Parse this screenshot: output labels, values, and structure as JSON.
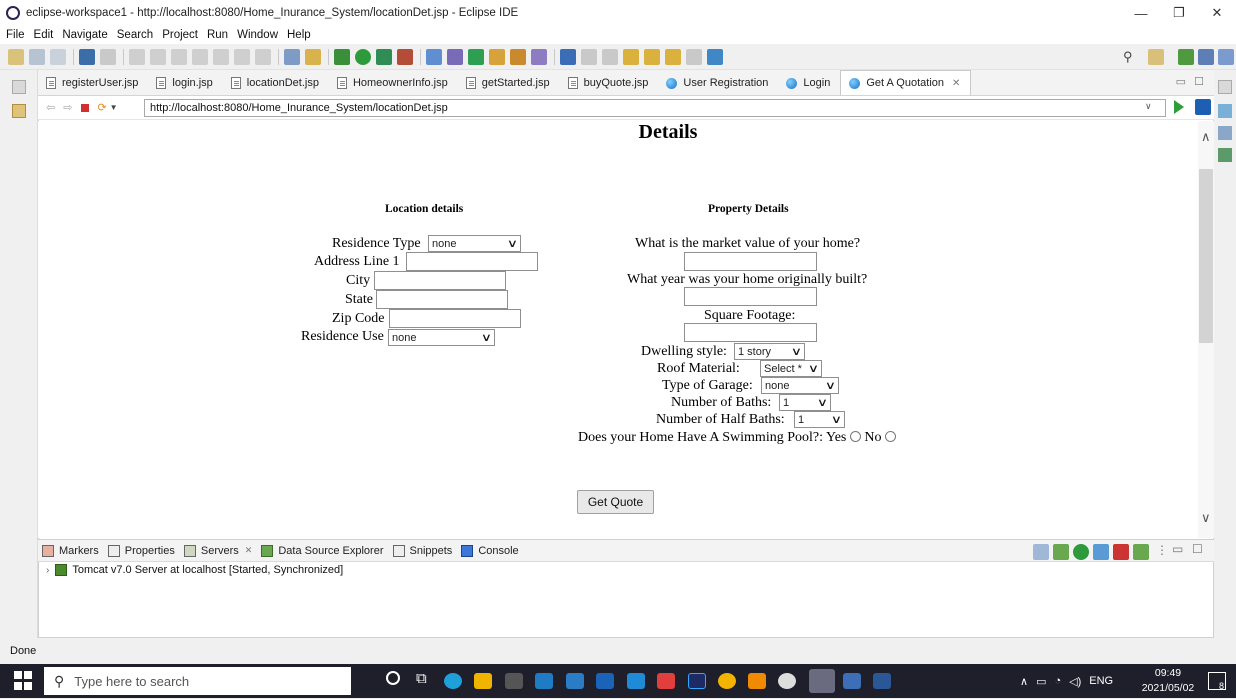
{
  "window": {
    "title": "eclipse-workspace1 - http://localhost:8080/Home_Inurance_System/locationDet.jsp - Eclipse IDE"
  },
  "menu": [
    "File",
    "Edit",
    "Navigate",
    "Search",
    "Project",
    "Run",
    "Window",
    "Help"
  ],
  "tabs": [
    {
      "label": "registerUser.jsp",
      "kind": "file"
    },
    {
      "label": "login.jsp",
      "kind": "file"
    },
    {
      "label": "locationDet.jsp",
      "kind": "file"
    },
    {
      "label": "HomeownerInfo.jsp",
      "kind": "file"
    },
    {
      "label": "getStarted.jsp",
      "kind": "file"
    },
    {
      "label": "buyQuote.jsp",
      "kind": "file"
    },
    {
      "label": "User Registration",
      "kind": "web"
    },
    {
      "label": "Login",
      "kind": "web"
    },
    {
      "label": "Get A Quotation",
      "kind": "web",
      "active": true
    }
  ],
  "browser": {
    "url": "http://localhost:8080/Home_Inurance_System/locationDet.jsp"
  },
  "page": {
    "heading": "Details",
    "location": {
      "title": "Location details",
      "residence_type_label": "Residence Type",
      "residence_type_value": "none",
      "address_label": "Address Line 1",
      "city_label": "City",
      "state_label": "State",
      "zip_label": "Zip Code",
      "residence_use_label": "Residence Use",
      "residence_use_value": "none"
    },
    "property": {
      "title": "Property Details",
      "market_value_label": "What is the market value of your home?",
      "year_built_label": "What year was your home originally built?",
      "sqft_label": "Square Footage:",
      "dwelling_label": "Dwelling style:",
      "dwelling_value": "1 story",
      "roof_label": "Roof Material:",
      "roof_value": "Select *",
      "garage_label": "Type of Garage:",
      "garage_value": "none",
      "baths_label": "Number of Baths:",
      "baths_value": "1",
      "half_baths_label": "Number of Half Baths:",
      "half_baths_value": "1",
      "pool_label": "Does your Home Have A Swimming Pool?:",
      "pool_yes": "Yes",
      "pool_no": "No"
    },
    "submit_label": "Get Quote"
  },
  "bottom_tabs": [
    "Markers",
    "Properties",
    "Servers",
    "Data Source Explorer",
    "Snippets",
    "Console"
  ],
  "server_entry": "Tomcat v7.0 Server at localhost  [Started, Synchronized]",
  "status_text": "Done",
  "taskbar": {
    "search_placeholder": "Type here to search",
    "lang": "ENG",
    "time": "09:49",
    "date": "2021/05/02",
    "badge": "8"
  },
  "colors": {
    "accent": "#1e5fb4",
    "taskbar": "#1f1f2b",
    "go": "#2e9e3a"
  }
}
